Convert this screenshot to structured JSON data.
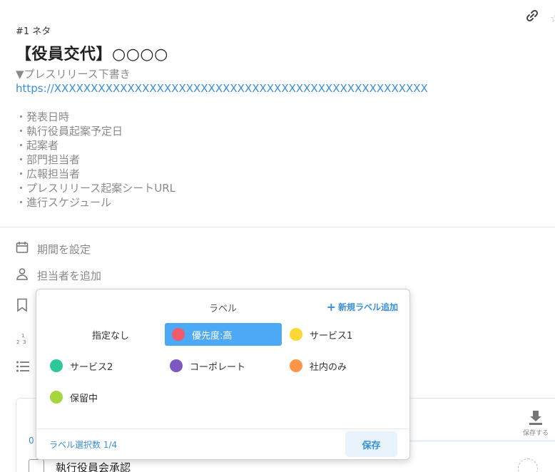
{
  "task": {
    "number": "#1 ネタ",
    "title_bracket": "【役員交代】",
    "title_rest": "○○○○",
    "description": {
      "heading": "▼プレスリリース下書き",
      "link": "https://XXXXXXXXXXXXXXXXXXXXXXXXXXXXXXXXXXXXXXXXXXXXXXXXXXX",
      "bullets": [
        "・発表日時",
        "・執行役員起案予定日",
        "・起案者",
        "・部門担当者",
        "・広報担当者",
        "・プレスリリース起案シートURL",
        "・進行スケジュール"
      ]
    }
  },
  "meta": {
    "period": "期間を設定",
    "assignee": "担当者を追加"
  },
  "popup": {
    "title": "ラベル",
    "new_label": "新規ラベル追加",
    "options": [
      {
        "label": "指定なし",
        "color": ""
      },
      {
        "label": "優先度:高",
        "color": "#f15a6a"
      },
      {
        "label": "サービス1",
        "color": "#fdd835"
      },
      {
        "label": "サービス2",
        "color": "#2ec79a"
      },
      {
        "label": "コーポレート",
        "color": "#7e57c2"
      },
      {
        "label": "社内のみ",
        "color": "#ff9548"
      },
      {
        "label": "保留中",
        "color": "#a5d63f"
      }
    ],
    "selected_count": "ラベル選択数 1/4",
    "save": "保存"
  },
  "bottom": {
    "save_side": "保存する",
    "progress": "0",
    "check_item": "執行役員会承認"
  },
  "colors": {
    "accent": "#3a8fd9",
    "selected_bg": "#4da8f5"
  }
}
